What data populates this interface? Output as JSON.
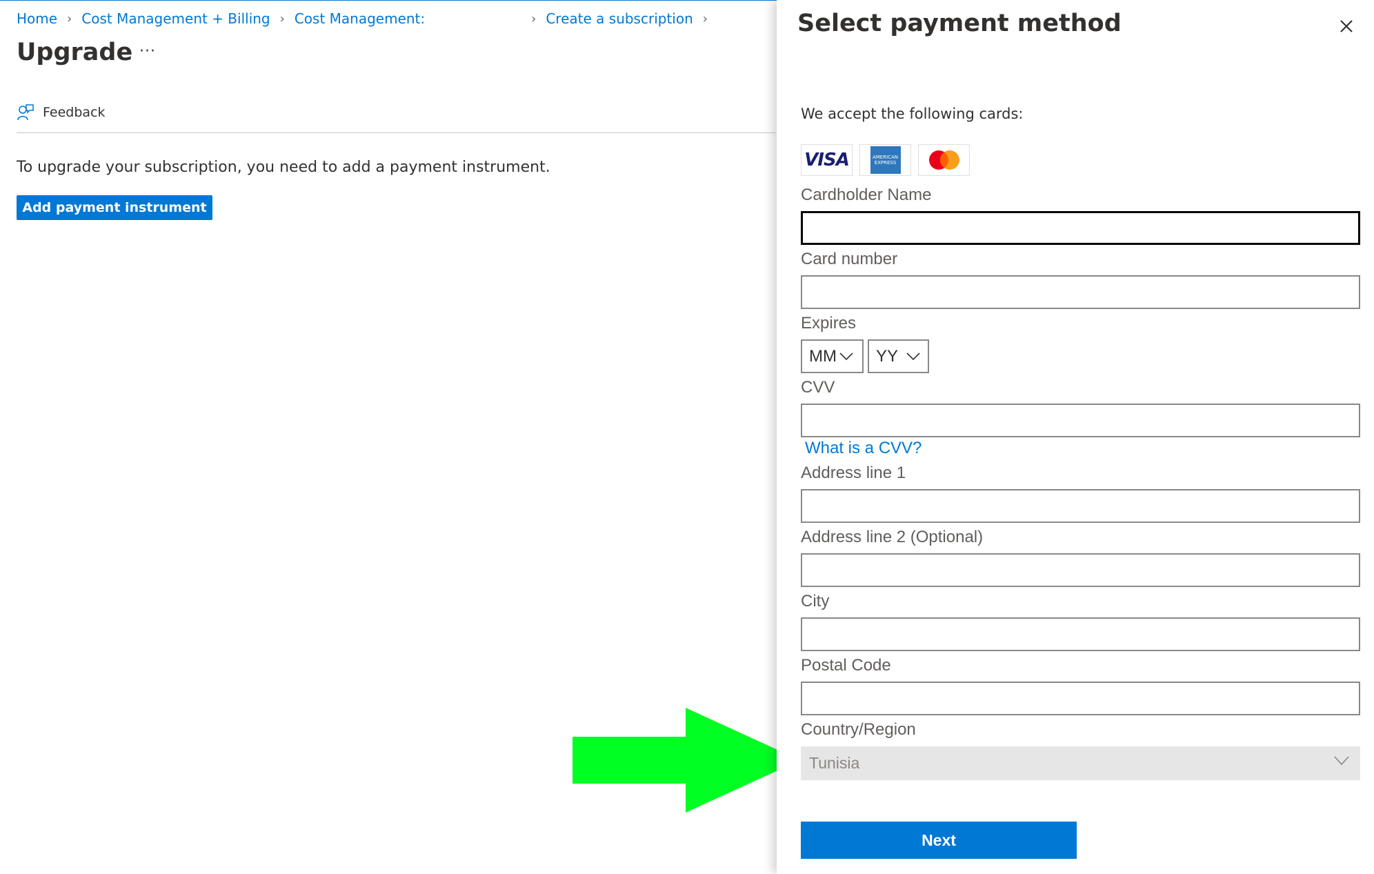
{
  "breadcrumb": {
    "home": "Home",
    "billing": "Cost Management + Billing",
    "cost_mgmt": "Cost Management:",
    "create_sub": "Create a subscription"
  },
  "page": {
    "title": "Upgrade",
    "more": "···",
    "feedback": "Feedback",
    "message": "To upgrade your subscription, you need to add a payment instrument.",
    "add_button": "Add payment instrument"
  },
  "panel": {
    "title": "Select payment method",
    "accept_text": "We accept the following cards:",
    "cards": [
      "VISA",
      "AMERICAN EXPRESS",
      "Mastercard"
    ],
    "labels": {
      "cardholder": "Cardholder Name",
      "card_number": "Card number",
      "expires": "Expires",
      "cvv": "CVV",
      "address1": "Address line 1",
      "address2": "Address line 2 (Optional)",
      "city": "City",
      "postal": "Postal Code",
      "country": "Country/Region"
    },
    "expires_month": "MM",
    "expires_year": "YY",
    "cvv_link": "What is a CVV?",
    "country_value": "Tunisia",
    "next_button": "Next"
  },
  "colors": {
    "accent": "#0078d4",
    "arrow": "#00ff22",
    "disabled_bg": "#e6e6e6"
  }
}
